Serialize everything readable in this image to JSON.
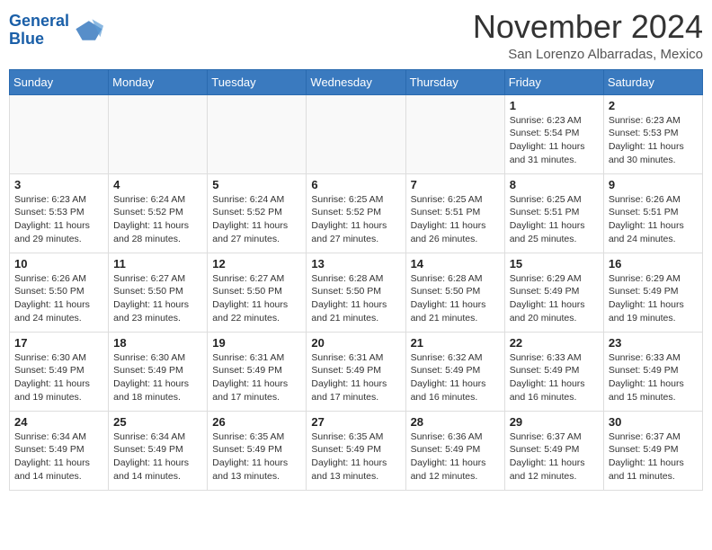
{
  "header": {
    "logo_line1": "General",
    "logo_line2": "Blue",
    "month_year": "November 2024",
    "location": "San Lorenzo Albarradas, Mexico"
  },
  "weekdays": [
    "Sunday",
    "Monday",
    "Tuesday",
    "Wednesday",
    "Thursday",
    "Friday",
    "Saturday"
  ],
  "weeks": [
    [
      {
        "day": "",
        "info": ""
      },
      {
        "day": "",
        "info": ""
      },
      {
        "day": "",
        "info": ""
      },
      {
        "day": "",
        "info": ""
      },
      {
        "day": "",
        "info": ""
      },
      {
        "day": "1",
        "info": "Sunrise: 6:23 AM\nSunset: 5:54 PM\nDaylight: 11 hours and 31 minutes."
      },
      {
        "day": "2",
        "info": "Sunrise: 6:23 AM\nSunset: 5:53 PM\nDaylight: 11 hours and 30 minutes."
      }
    ],
    [
      {
        "day": "3",
        "info": "Sunrise: 6:23 AM\nSunset: 5:53 PM\nDaylight: 11 hours and 29 minutes."
      },
      {
        "day": "4",
        "info": "Sunrise: 6:24 AM\nSunset: 5:52 PM\nDaylight: 11 hours and 28 minutes."
      },
      {
        "day": "5",
        "info": "Sunrise: 6:24 AM\nSunset: 5:52 PM\nDaylight: 11 hours and 27 minutes."
      },
      {
        "day": "6",
        "info": "Sunrise: 6:25 AM\nSunset: 5:52 PM\nDaylight: 11 hours and 27 minutes."
      },
      {
        "day": "7",
        "info": "Sunrise: 6:25 AM\nSunset: 5:51 PM\nDaylight: 11 hours and 26 minutes."
      },
      {
        "day": "8",
        "info": "Sunrise: 6:25 AM\nSunset: 5:51 PM\nDaylight: 11 hours and 25 minutes."
      },
      {
        "day": "9",
        "info": "Sunrise: 6:26 AM\nSunset: 5:51 PM\nDaylight: 11 hours and 24 minutes."
      }
    ],
    [
      {
        "day": "10",
        "info": "Sunrise: 6:26 AM\nSunset: 5:50 PM\nDaylight: 11 hours and 24 minutes."
      },
      {
        "day": "11",
        "info": "Sunrise: 6:27 AM\nSunset: 5:50 PM\nDaylight: 11 hours and 23 minutes."
      },
      {
        "day": "12",
        "info": "Sunrise: 6:27 AM\nSunset: 5:50 PM\nDaylight: 11 hours and 22 minutes."
      },
      {
        "day": "13",
        "info": "Sunrise: 6:28 AM\nSunset: 5:50 PM\nDaylight: 11 hours and 21 minutes."
      },
      {
        "day": "14",
        "info": "Sunrise: 6:28 AM\nSunset: 5:50 PM\nDaylight: 11 hours and 21 minutes."
      },
      {
        "day": "15",
        "info": "Sunrise: 6:29 AM\nSunset: 5:49 PM\nDaylight: 11 hours and 20 minutes."
      },
      {
        "day": "16",
        "info": "Sunrise: 6:29 AM\nSunset: 5:49 PM\nDaylight: 11 hours and 19 minutes."
      }
    ],
    [
      {
        "day": "17",
        "info": "Sunrise: 6:30 AM\nSunset: 5:49 PM\nDaylight: 11 hours and 19 minutes."
      },
      {
        "day": "18",
        "info": "Sunrise: 6:30 AM\nSunset: 5:49 PM\nDaylight: 11 hours and 18 minutes."
      },
      {
        "day": "19",
        "info": "Sunrise: 6:31 AM\nSunset: 5:49 PM\nDaylight: 11 hours and 17 minutes."
      },
      {
        "day": "20",
        "info": "Sunrise: 6:31 AM\nSunset: 5:49 PM\nDaylight: 11 hours and 17 minutes."
      },
      {
        "day": "21",
        "info": "Sunrise: 6:32 AM\nSunset: 5:49 PM\nDaylight: 11 hours and 16 minutes."
      },
      {
        "day": "22",
        "info": "Sunrise: 6:33 AM\nSunset: 5:49 PM\nDaylight: 11 hours and 16 minutes."
      },
      {
        "day": "23",
        "info": "Sunrise: 6:33 AM\nSunset: 5:49 PM\nDaylight: 11 hours and 15 minutes."
      }
    ],
    [
      {
        "day": "24",
        "info": "Sunrise: 6:34 AM\nSunset: 5:49 PM\nDaylight: 11 hours and 14 minutes."
      },
      {
        "day": "25",
        "info": "Sunrise: 6:34 AM\nSunset: 5:49 PM\nDaylight: 11 hours and 14 minutes."
      },
      {
        "day": "26",
        "info": "Sunrise: 6:35 AM\nSunset: 5:49 PM\nDaylight: 11 hours and 13 minutes."
      },
      {
        "day": "27",
        "info": "Sunrise: 6:35 AM\nSunset: 5:49 PM\nDaylight: 11 hours and 13 minutes."
      },
      {
        "day": "28",
        "info": "Sunrise: 6:36 AM\nSunset: 5:49 PM\nDaylight: 11 hours and 12 minutes."
      },
      {
        "day": "29",
        "info": "Sunrise: 6:37 AM\nSunset: 5:49 PM\nDaylight: 11 hours and 12 minutes."
      },
      {
        "day": "30",
        "info": "Sunrise: 6:37 AM\nSunset: 5:49 PM\nDaylight: 11 hours and 11 minutes."
      }
    ]
  ]
}
